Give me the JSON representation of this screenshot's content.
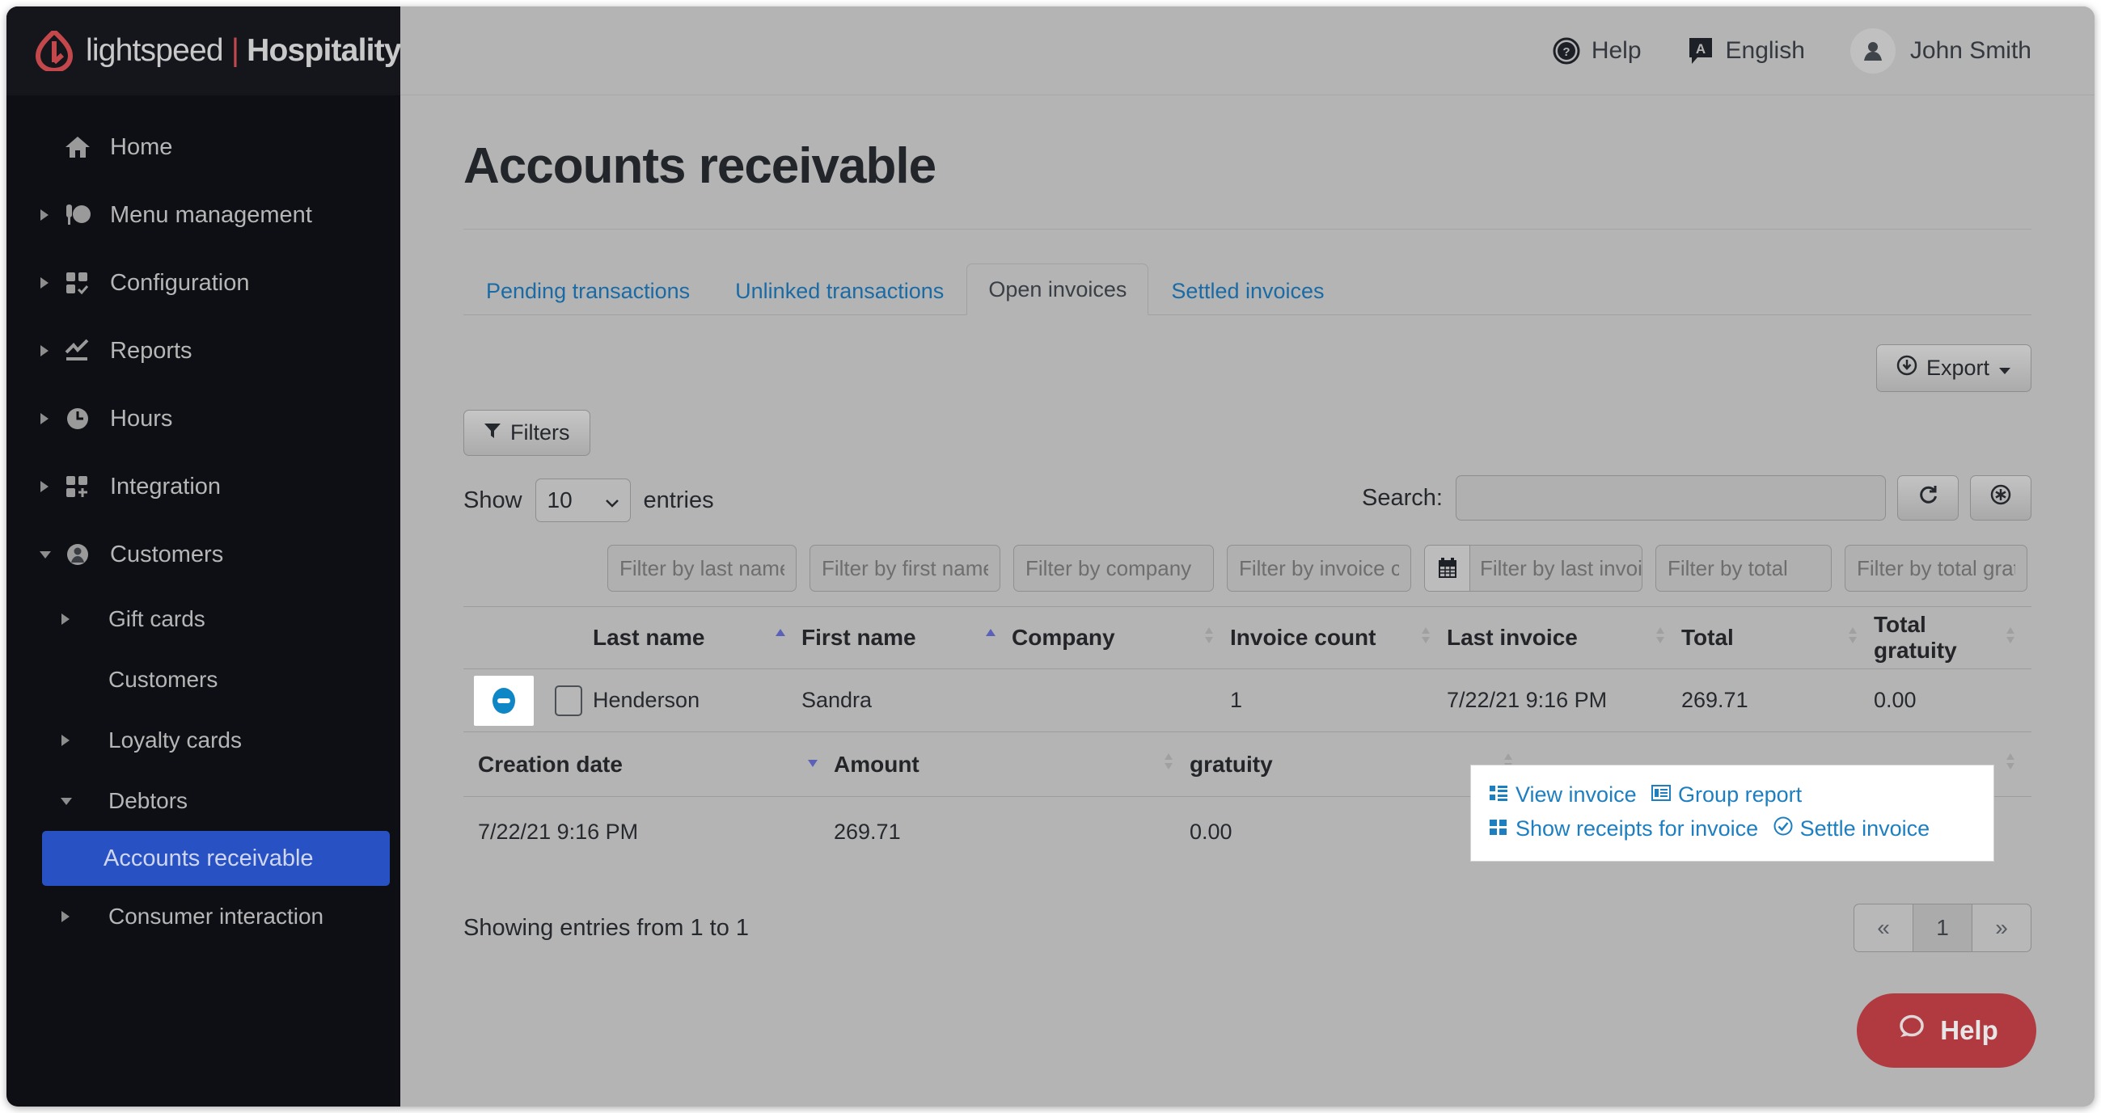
{
  "brand": {
    "name": "lightspeed",
    "separator": "|",
    "product": "Hospitality"
  },
  "topbar": {
    "help_label": "Help",
    "language_label": "English",
    "language_badge": "A",
    "user_name": "John Smith"
  },
  "sidebar": {
    "items": [
      {
        "label": "Home",
        "icon": "home-icon",
        "level": 1,
        "expandable": false,
        "active": false
      },
      {
        "label": "Menu management",
        "icon": "menu-management-icon",
        "level": 1,
        "expandable": true,
        "expanded": false,
        "active": false
      },
      {
        "label": "Configuration",
        "icon": "configuration-icon",
        "level": 1,
        "expandable": true,
        "expanded": false,
        "active": false
      },
      {
        "label": "Reports",
        "icon": "reports-icon",
        "level": 1,
        "expandable": true,
        "expanded": false,
        "active": false
      },
      {
        "label": "Hours",
        "icon": "clock-icon",
        "level": 1,
        "expandable": true,
        "expanded": false,
        "active": false
      },
      {
        "label": "Integration",
        "icon": "integration-icon",
        "level": 1,
        "expandable": true,
        "expanded": false,
        "active": false
      },
      {
        "label": "Customers",
        "icon": "user-icon",
        "level": 1,
        "expandable": true,
        "expanded": true,
        "active": false
      },
      {
        "label": "Gift cards",
        "icon": "",
        "level": 2,
        "expandable": true,
        "expanded": false,
        "active": false
      },
      {
        "label": "Customers",
        "icon": "",
        "level": 2,
        "expandable": false,
        "active": false
      },
      {
        "label": "Loyalty cards",
        "icon": "",
        "level": 2,
        "expandable": true,
        "expanded": false,
        "active": false
      },
      {
        "label": "Debtors",
        "icon": "",
        "level": 2,
        "expandable": true,
        "expanded": true,
        "active": false
      },
      {
        "label": "Accounts receivable",
        "icon": "",
        "level": 3,
        "expandable": false,
        "active": true
      },
      {
        "label": "Consumer interaction",
        "icon": "",
        "level": 2,
        "expandable": true,
        "expanded": false,
        "active": false
      }
    ],
    "active_color": "#2851c4"
  },
  "page": {
    "title": "Accounts receivable"
  },
  "tabs": [
    {
      "label": "Pending transactions",
      "active": false
    },
    {
      "label": "Unlinked transactions",
      "active": false
    },
    {
      "label": "Open invoices",
      "active": true
    },
    {
      "label": "Settled invoices",
      "active": false
    }
  ],
  "toolbar": {
    "export_label": "Export",
    "filters_label": "Filters",
    "show_label": "Show",
    "entries_label": "entries",
    "page_size": "10",
    "search_label": "Search:",
    "search_value": "",
    "search_placeholder": "",
    "refresh_icon": "refresh-icon",
    "clear_icon": "clear-icon"
  },
  "filter_inputs": [
    {
      "placeholder": "Filter by last name",
      "calendar": false
    },
    {
      "placeholder": "Filter by first name",
      "calendar": false
    },
    {
      "placeholder": "Filter by company",
      "calendar": false
    },
    {
      "placeholder": "Filter by invoice count",
      "calendar": false
    },
    {
      "placeholder": "Filter by last invoice",
      "calendar": true
    },
    {
      "placeholder": "Filter by total",
      "calendar": false
    },
    {
      "placeholder": "Filter by total gratuity",
      "calendar": false
    }
  ],
  "table": {
    "columns": [
      {
        "label": "Last name",
        "sort": "asc"
      },
      {
        "label": "First name",
        "sort": "asc"
      },
      {
        "label": "Company",
        "sort": "none"
      },
      {
        "label": "Invoice count",
        "sort": "none"
      },
      {
        "label": "Last invoice",
        "sort": "none"
      },
      {
        "label": "Total",
        "sort": "none"
      },
      {
        "label": "Total gratuity",
        "sort": "none"
      }
    ],
    "rows": [
      {
        "expanded": true,
        "checked": false,
        "last_name": "Henderson",
        "first_name": "Sandra",
        "company": "",
        "invoice_count": "1",
        "last_invoice": "7/22/21 9:16 PM",
        "total": "269.71",
        "total_gratuity": "0.00"
      }
    ]
  },
  "subtable": {
    "columns": [
      {
        "label": "Creation date",
        "sort": "desc"
      },
      {
        "label": "Amount",
        "sort": "none"
      },
      {
        "label": "gratuity",
        "sort": "none"
      },
      {
        "label": "",
        "sort": "none"
      }
    ],
    "rows": [
      {
        "creation_date": "7/22/21 9:16 PM",
        "amount": "269.71",
        "gratuity": "0.00"
      }
    ],
    "actions": [
      {
        "label": "View invoice",
        "icon": "list-view-icon"
      },
      {
        "label": "Group report",
        "icon": "report-icon"
      },
      {
        "label": "Show receipts for invoice",
        "icon": "grid-icon"
      },
      {
        "label": "Settle invoice",
        "icon": "check-circle-icon"
      }
    ]
  },
  "footer": {
    "showing_text": "Showing entries from 1 to 1",
    "pagination": [
      {
        "label": "«",
        "active": false
      },
      {
        "label": "1",
        "active": true
      },
      {
        "label": "»",
        "active": false
      }
    ]
  },
  "help_widget": {
    "label": "Help",
    "color": "#b03a3f",
    "icon": "chat-bubble-icon"
  }
}
